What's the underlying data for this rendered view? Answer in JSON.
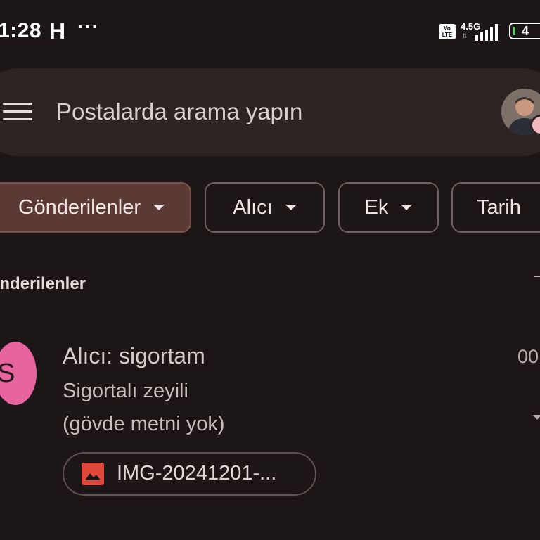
{
  "status_bar": {
    "time": "1:28",
    "carrier_icon": "H",
    "more": "···",
    "volte": "Vo LTE",
    "network": "4.5G",
    "battery": "4"
  },
  "search": {
    "placeholder": "Postalarda arama yapın"
  },
  "filters": [
    {
      "label": "Gönderilenler",
      "active": true
    },
    {
      "label": "Alıcı",
      "active": false
    },
    {
      "label": "Ek",
      "active": false
    },
    {
      "label": "Tarih",
      "active": false
    }
  ],
  "section": {
    "title": "Gönderilenler"
  },
  "email": {
    "avatar_letter": "S",
    "sender": "Alıcı: sigortam",
    "time": "00",
    "subject": "Sigortalı zeyili",
    "snippet": "(gövde metni yok)",
    "attachment": "IMG-20241201-..."
  },
  "colors": {
    "background": "#1c1616",
    "search_bar": "#2d2322",
    "active_chip": "#5b3a36",
    "avatar_pink": "#e8649e",
    "image_icon_red": "#e2473b",
    "battery_green": "#52d46b"
  },
  "icons": [
    "menu-icon",
    "profile-avatar",
    "chevron-down-icon",
    "image-icon",
    "signal-icon",
    "battery-icon"
  ]
}
